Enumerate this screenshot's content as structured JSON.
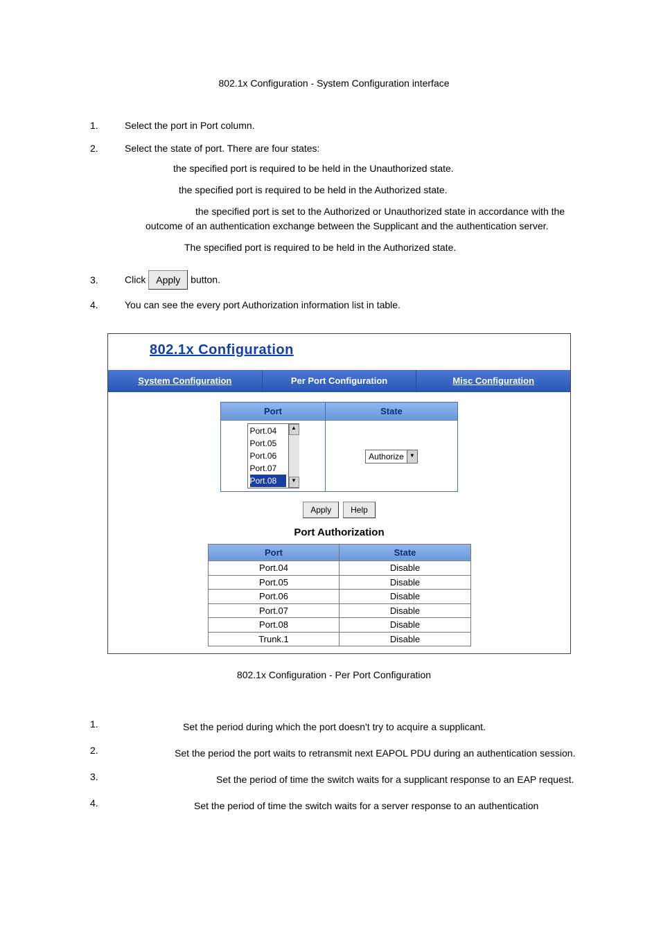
{
  "caption_top": "802.1x Configuration - System Configuration interface",
  "list1": {
    "i1": {
      "num": "1.",
      "text": "Select the port in Port column."
    },
    "i2": {
      "num": "2.",
      "intro": "Select the state of port. There are four states:",
      "b1": "the specified port is required to be held in the Unauthorized state.",
      "b2": "the specified port is required to be held in the Authorized state.",
      "b3": "the specified port is set to the Authorized or Unauthorized state in accordance with the outcome of an authentication exchange between the Supplicant and the authentication server.",
      "b4": "The specified port is required to be held in the Authorized state."
    },
    "i3": {
      "num": "3.",
      "pre": "Click ",
      "btn": "Apply",
      "post": " button."
    },
    "i4": {
      "num": "4.",
      "text": "You can see the every port Authorization information list in table."
    }
  },
  "shot": {
    "title": "802.1x Configuration",
    "tabs": {
      "sys": "System Configuration",
      "per": "Per Port Configuration",
      "misc": "Misc Configuration"
    },
    "io_headers": {
      "port": "Port",
      "state": "State"
    },
    "port_list": [
      "Port.04",
      "Port.05",
      "Port.06",
      "Port.07",
      "Port.08"
    ],
    "state_selected": "Authorize",
    "apply_label": "Apply",
    "help_label": "Help",
    "pa_title": "Port Authorization",
    "pa_headers": {
      "port": "Port",
      "state": "State"
    },
    "pa_rows": [
      {
        "port": "Port.04",
        "state": "Disable"
      },
      {
        "port": "Port.05",
        "state": "Disable"
      },
      {
        "port": "Port.06",
        "state": "Disable"
      },
      {
        "port": "Port.07",
        "state": "Disable"
      },
      {
        "port": "Port.08",
        "state": "Disable"
      },
      {
        "port": "Trunk.1",
        "state": "Disable"
      }
    ]
  },
  "caption_bottom": "802.1x Configuration - Per Port Configuration",
  "list2": {
    "i1": {
      "num": "1.",
      "text": "Set the period during which the port doesn't try to acquire a supplicant."
    },
    "i2": {
      "num": "2.",
      "text": "Set the period the port waits to retransmit next EAPOL PDU during an authentication session."
    },
    "i3": {
      "num": "3.",
      "text": "Set the period of time the switch waits for a supplicant response to an EAP request."
    },
    "i4": {
      "num": "4.",
      "text": "Set the period of time the switch waits for a server response to an authentication"
    }
  }
}
